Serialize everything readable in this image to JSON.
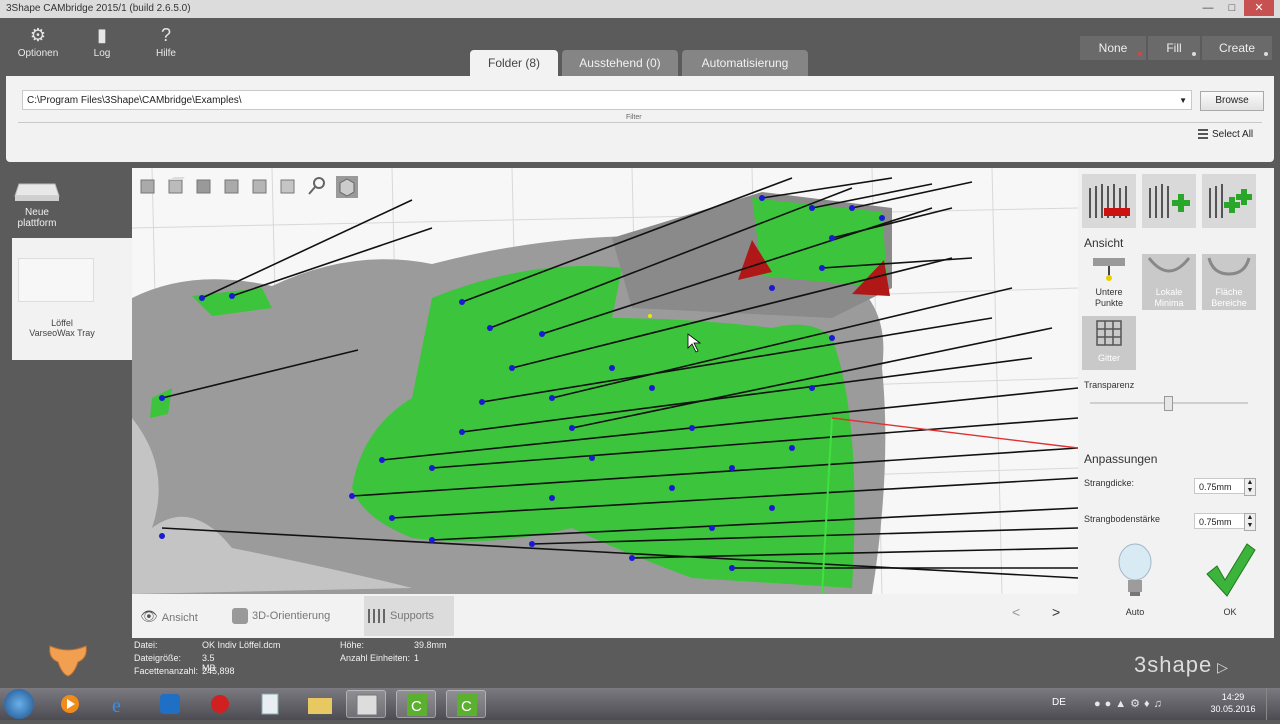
{
  "window": {
    "title": "3Shape CAMbridge 2015/1 (build 2.6.5.0)"
  },
  "toolbar": {
    "options_label": "Optionen",
    "log_label": "Log",
    "help_label": "Hilfe"
  },
  "tabs": [
    {
      "label": "Folder (8)"
    },
    {
      "label": "Ausstehend (0)"
    },
    {
      "label": "Automatisierung"
    }
  ],
  "top_right": {
    "none_label": "None",
    "fill_label": "Fill",
    "create_label": "Create"
  },
  "folder_panel": {
    "path": "C:\\Program Files\\3Shape\\CAMbridge\\Examples\\",
    "browse_label": "Browse",
    "filter_label": "Filter",
    "select_all_label": "Select All"
  },
  "left_panel": {
    "new_platform_label": "Neue plattform",
    "tray_line1": "Löffel",
    "tray_line2": "VarseoWax Tray"
  },
  "bottom_tabs": {
    "view_label": "Ansicht",
    "orient_label": "3D-Orientierung",
    "supports_label": "Supports"
  },
  "nav": {
    "prev": "<",
    "next": ">"
  },
  "right_panel": {
    "ansicht_heading": "Ansicht",
    "untere_punkte": "Untere Punkte",
    "lokale_minima": "Lokale Minima",
    "flache_bereiche": "Fläche Bereiche",
    "gitter": "Gitter",
    "transparency_label": "Transparenz",
    "anpassungen_heading": "Anpassungen",
    "strangdicke_label": "Strangdicke:",
    "strangdicke_value": "0.75mm",
    "strangbodenstaerke_label": "Strangbodenstärke",
    "strangbodenstaerke_value": "0.75mm",
    "auto_label": "Auto",
    "ok_label": "OK"
  },
  "info": {
    "file_label": "Datei:",
    "file_value": "OK Indiv Löffel.dcm",
    "size_label": "Dateigröße:",
    "size_value": "3.5 MB",
    "facets_label": "Facettenanzahl:",
    "facets_value": "245,898",
    "height_label": "Höhe:",
    "height_value": "39.8mm",
    "units_label": "Anzahl Einheiten:",
    "units_value": "1"
  },
  "brand": "3shape",
  "taskbar": {
    "language": "DE",
    "time": "14:29",
    "date": "30.05.2016"
  }
}
